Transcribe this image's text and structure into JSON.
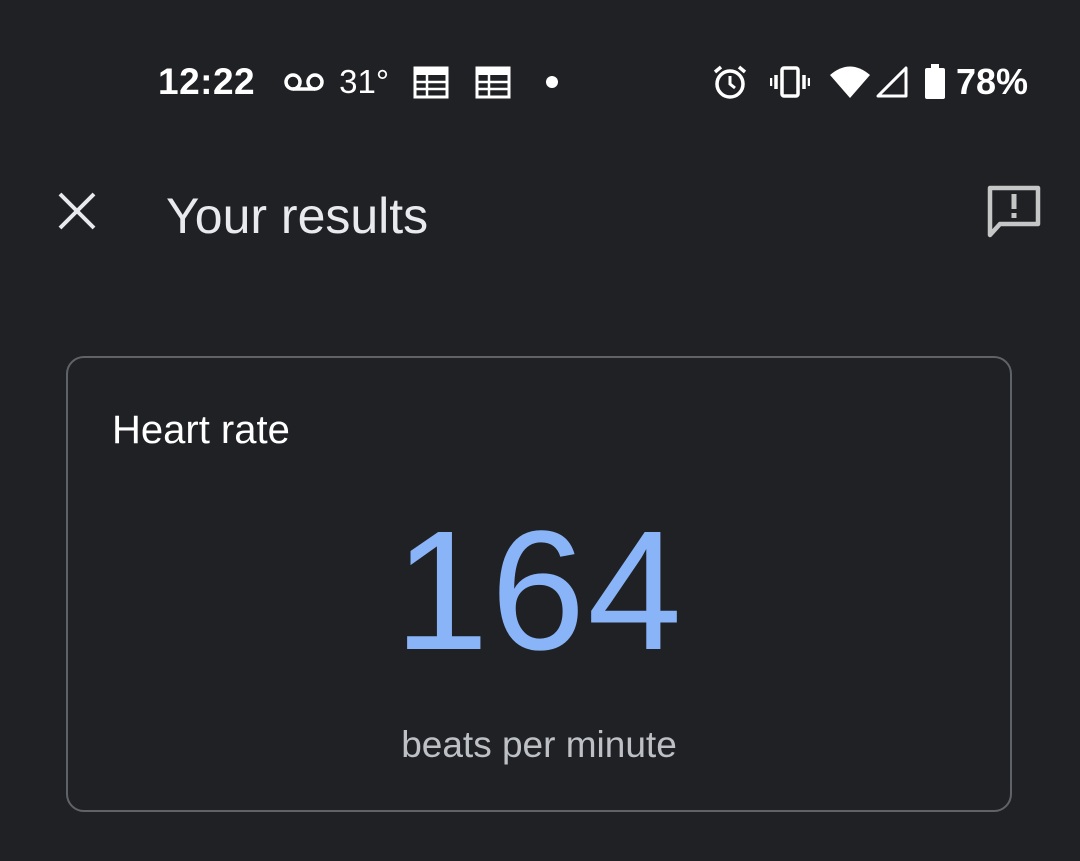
{
  "status_bar": {
    "time": "12:22",
    "temperature": "31°",
    "battery_percent": "78%",
    "icons_left": [
      "voicemail-icon",
      "calendar-icon",
      "calendar-icon",
      "notification-dot-icon"
    ],
    "icons_right": [
      "alarm-icon",
      "vibrate-icon",
      "wifi-icon",
      "cell-signal-icon",
      "battery-icon"
    ]
  },
  "app_bar": {
    "title": "Your results",
    "close_icon": "close-icon",
    "feedback_icon": "feedback-icon"
  },
  "result_card": {
    "title": "Heart rate",
    "value": "164",
    "unit": "beats per minute"
  },
  "colors": {
    "background": "#202125",
    "accent_value": "#8ab4f8",
    "card_border": "#5f6368",
    "secondary_text": "#bdc1c6"
  }
}
